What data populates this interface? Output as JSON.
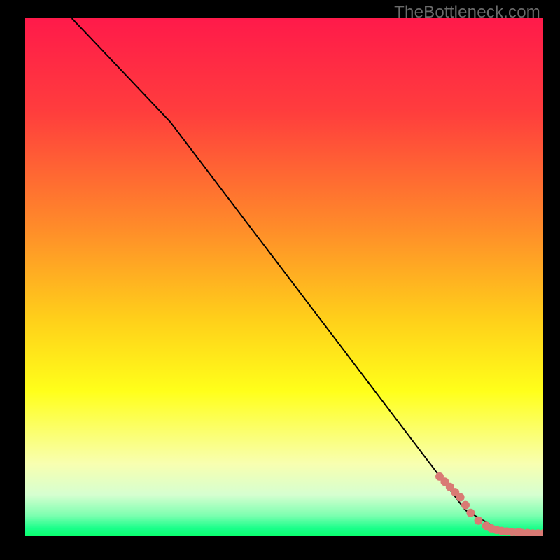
{
  "watermark": "TheBottleneck.com",
  "chart_data": {
    "type": "line",
    "title": "",
    "xlabel": "",
    "ylabel": "",
    "xlim": [
      0,
      100
    ],
    "ylim": [
      0,
      100
    ],
    "legend": false,
    "grid": false,
    "series": [
      {
        "name": "curve",
        "type": "line",
        "color": "#000000",
        "x": [
          9,
          28,
          85,
          92,
          100
        ],
        "y": [
          100,
          80,
          5,
          1,
          0.5
        ]
      },
      {
        "name": "points",
        "type": "scatter",
        "color": "#d97a74",
        "x": [
          80,
          81,
          82,
          83,
          84,
          85,
          86,
          87.5,
          89,
          90,
          91,
          92,
          93,
          94,
          95,
          95.5,
          96,
          97,
          98,
          99,
          100
        ],
        "y": [
          11.5,
          10.5,
          9.5,
          8.5,
          7.5,
          6,
          4.5,
          3,
          2,
          1.5,
          1.2,
          1,
          0.9,
          0.8,
          0.7,
          0.7,
          0.6,
          0.6,
          0.5,
          0.5,
          0.5
        ]
      }
    ],
    "background_gradient": {
      "stops": [
        {
          "pos": 0.0,
          "color": "#ff1a4a"
        },
        {
          "pos": 0.18,
          "color": "#ff3d3d"
        },
        {
          "pos": 0.4,
          "color": "#ff8a2a"
        },
        {
          "pos": 0.58,
          "color": "#ffcf1a"
        },
        {
          "pos": 0.72,
          "color": "#ffff1a"
        },
        {
          "pos": 0.86,
          "color": "#f8ffb0"
        },
        {
          "pos": 0.92,
          "color": "#d6ffd0"
        },
        {
          "pos": 0.96,
          "color": "#7dffb0"
        },
        {
          "pos": 0.985,
          "color": "#1aff8a"
        },
        {
          "pos": 1.0,
          "color": "#0aff6f"
        }
      ]
    }
  }
}
